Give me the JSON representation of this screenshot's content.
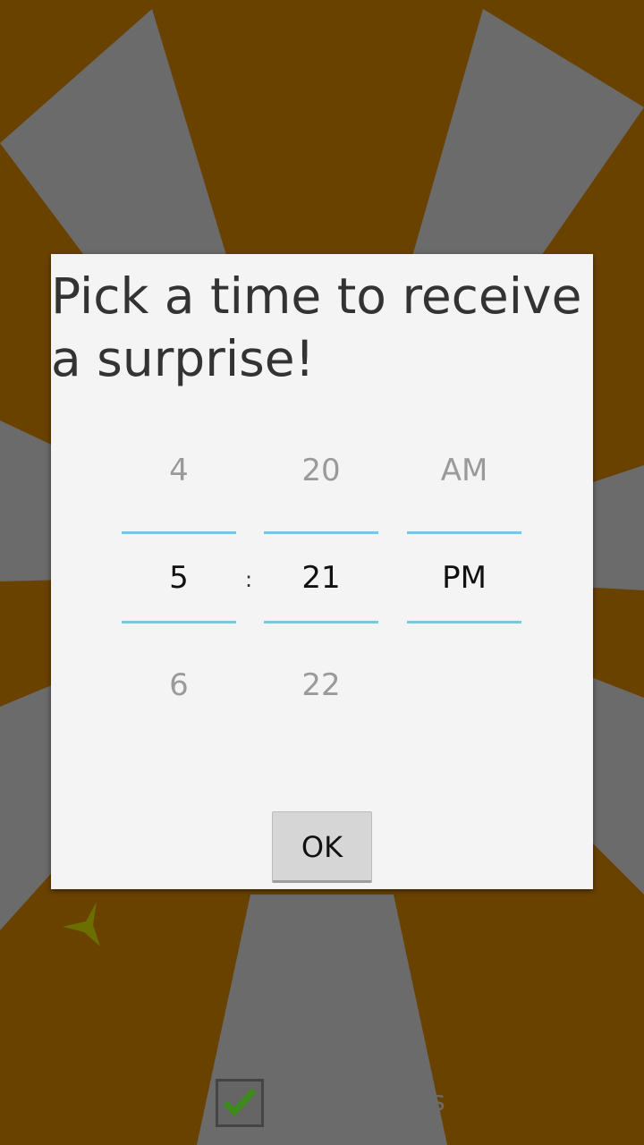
{
  "dialog": {
    "title": "Pick a time to receive a surprise!",
    "ok_label": "OK"
  },
  "picker": {
    "hour": {
      "prev": "4",
      "current": "5",
      "next": "6"
    },
    "minute": {
      "prev": "20",
      "current": "21",
      "next": "22"
    },
    "ampm": {
      "prev": "AM",
      "current": "PM",
      "next": ""
    },
    "separator": ":"
  },
  "background": {
    "notifications_label": "Notifications",
    "colors": {
      "brown": "#6a4200",
      "gray": "#6b6b6b",
      "accent": "#7ac6de"
    }
  }
}
